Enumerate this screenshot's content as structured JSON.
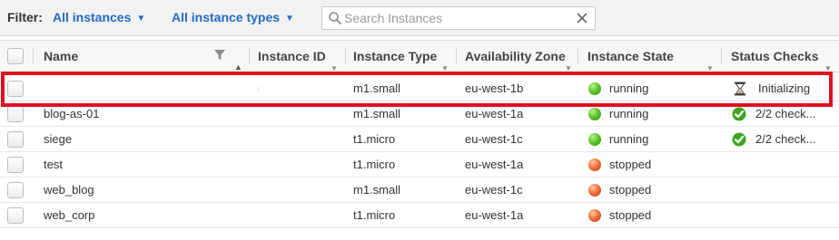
{
  "filter": {
    "label": "Filter:",
    "instances_dropdown": "All instances",
    "types_dropdown": "All instance types",
    "search_placeholder": "Search Instances"
  },
  "columns": {
    "name": "Name",
    "instance_id": "Instance ID",
    "instance_type": "Instance Type",
    "availability_zone": "Availability Zone",
    "instance_state": "Instance State",
    "status_checks": "Status Checks"
  },
  "rows": [
    {
      "name": "",
      "instance_type": "m1.small",
      "zone": "eu-west-1b",
      "state": "running",
      "state_color": "#4caf24",
      "status_icon": "hourglass-icon",
      "status": "Initializing"
    },
    {
      "name": "blog-as-01",
      "instance_type": "m1.small",
      "zone": "eu-west-1a",
      "state": "running",
      "state_color": "#4caf24",
      "status_icon": "check-icon",
      "status": "2/2 check..."
    },
    {
      "name": "siege",
      "instance_type": "t1.micro",
      "zone": "eu-west-1c",
      "state": "running",
      "state_color": "#4caf24",
      "status_icon": "check-icon",
      "status": "2/2 check..."
    },
    {
      "name": "test",
      "instance_type": "t1.micro",
      "zone": "eu-west-1a",
      "state": "stopped",
      "state_color": "#e8602c",
      "status_icon": "",
      "status": ""
    },
    {
      "name": "web_blog",
      "instance_type": "m1.small",
      "zone": "eu-west-1c",
      "state": "stopped",
      "state_color": "#e8602c",
      "status_icon": "",
      "status": ""
    },
    {
      "name": "web_corp",
      "instance_type": "t1.micro",
      "zone": "eu-west-1a",
      "state": "stopped",
      "state_color": "#e8602c",
      "status_icon": "",
      "status": ""
    }
  ],
  "colors": {
    "link_blue": "#1f6bc3",
    "highlight_red": "#e0101f"
  }
}
